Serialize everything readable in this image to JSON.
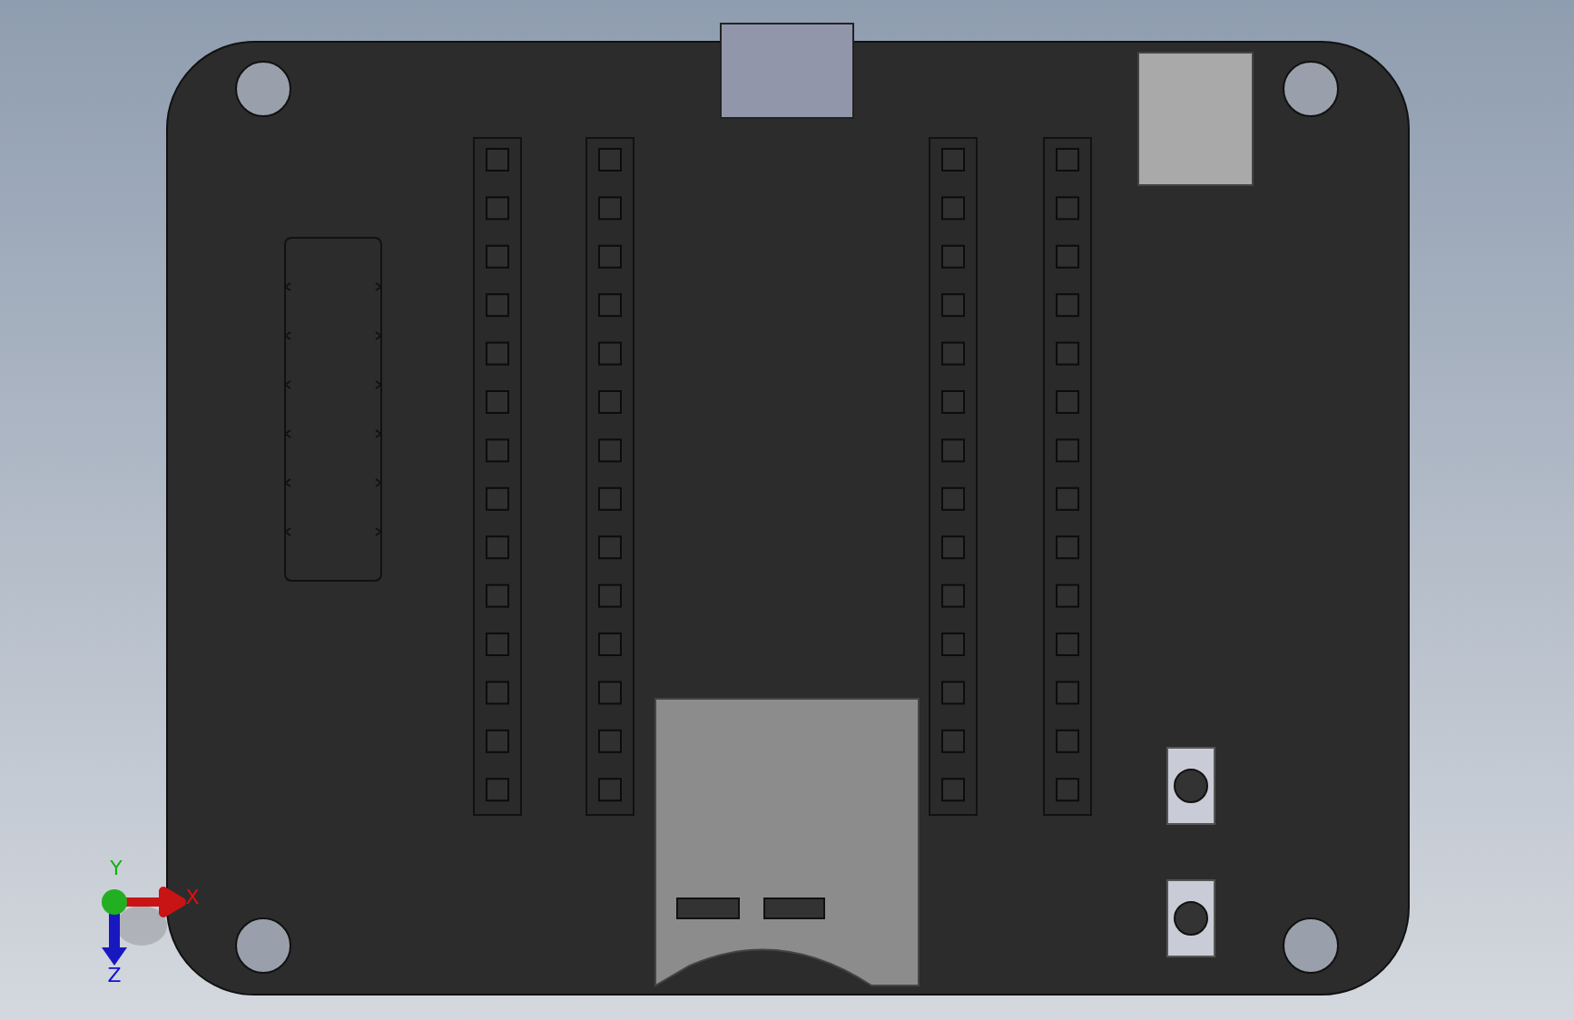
{
  "axis_triad": {
    "labels": [
      {
        "kind": "x",
        "text": "X"
      },
      {
        "kind": "y",
        "text": "Y"
      },
      {
        "kind": "z",
        "text": "Z"
      }
    ]
  }
}
